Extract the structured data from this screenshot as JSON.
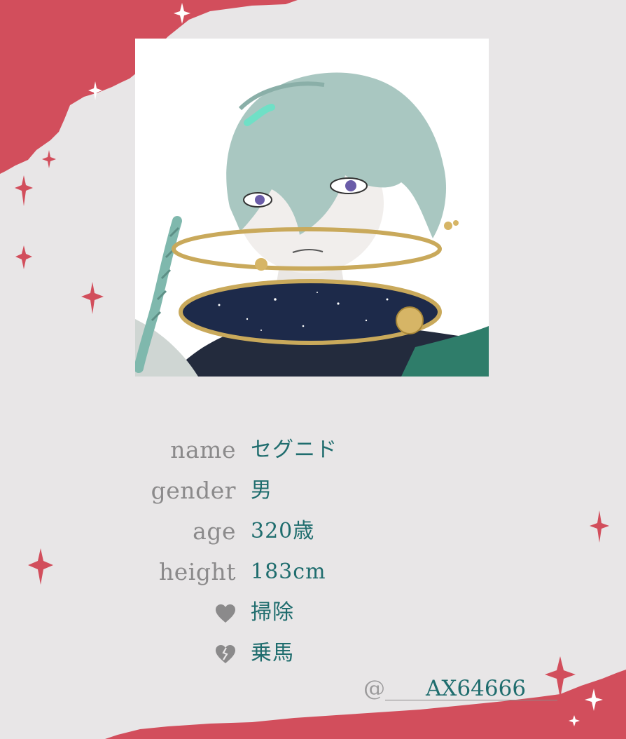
{
  "profile": {
    "rows": [
      {
        "label": "name",
        "value": "セグニド"
      },
      {
        "label": "gender",
        "value": "男"
      },
      {
        "label": "age",
        "value": "320歳"
      },
      {
        "label": "height",
        "value": "183cm"
      },
      {
        "icon": "heart-icon",
        "value": "掃除"
      },
      {
        "icon": "broken-heart-icon",
        "value": "乗馬"
      }
    ]
  },
  "credit": {
    "at": "@",
    "handle": "AX64666"
  },
  "colors": {
    "background": "#e8e6e7",
    "accent_red": "#d24e5c",
    "label_gray": "#8b8a8b",
    "value_teal": "#1f6d6e"
  }
}
